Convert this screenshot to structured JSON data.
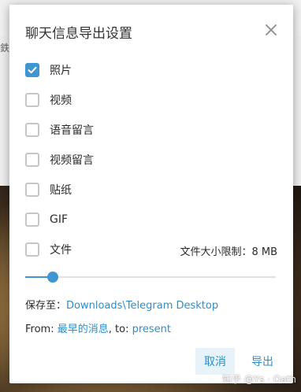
{
  "dialog": {
    "title": "聊天信息导出设置",
    "options": [
      {
        "label": "照片",
        "checked": true
      },
      {
        "label": "视频",
        "checked": false
      },
      {
        "label": "语音留言",
        "checked": false
      },
      {
        "label": "视频留言",
        "checked": false
      },
      {
        "label": "贴纸",
        "checked": false
      },
      {
        "label": "GIF",
        "checked": false
      },
      {
        "label": "文件",
        "checked": false
      }
    ],
    "size_limit": "文件大小限制：8 MB",
    "slider_fraction": 0.11,
    "save_to_label": "保存至：",
    "save_path": "Downloads\\Telegram Desktop",
    "from_label": "From: ",
    "from_value": "最早的消息",
    "to_label": ", to: ",
    "to_value": "present",
    "cancel_label": "取消",
    "export_label": "导出"
  },
  "background": {
    "side_peek_text": "鉄"
  },
  "watermark": "知乎 @Ys · Oath",
  "colors": {
    "accent": "#3f96d0",
    "link": "#2e8fc8"
  }
}
